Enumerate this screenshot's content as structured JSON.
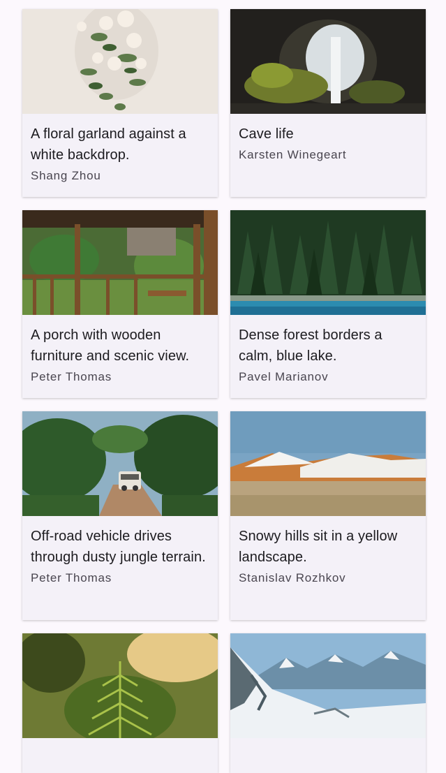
{
  "cards": [
    {
      "title": "A floral garland against a white backdrop.",
      "author": "Shang Zhou",
      "image": "floral-garland-photo"
    },
    {
      "title": "Cave life",
      "author": "Karsten Winegeart",
      "image": "cave-waterfall-photo"
    },
    {
      "title": "A porch with wooden furniture and scenic view.",
      "author": "Peter Thomas",
      "image": "porch-photo"
    },
    {
      "title": "Dense forest borders a calm, blue lake.",
      "author": "Pavel Marianov",
      "image": "forest-lake-photo"
    },
    {
      "title": "Off-road vehicle drives through dusty jungle terrain.",
      "author": "Peter Thomas",
      "image": "offroad-vehicle-photo"
    },
    {
      "title": "Snowy hills sit in a yellow landscape.",
      "author": "Stanislav Rozhkov",
      "image": "snowy-hills-photo"
    },
    {
      "title": "",
      "author": "",
      "image": "fern-forest-photo"
    },
    {
      "title": "",
      "author": "",
      "image": "snowy-mountains-photo"
    }
  ]
}
